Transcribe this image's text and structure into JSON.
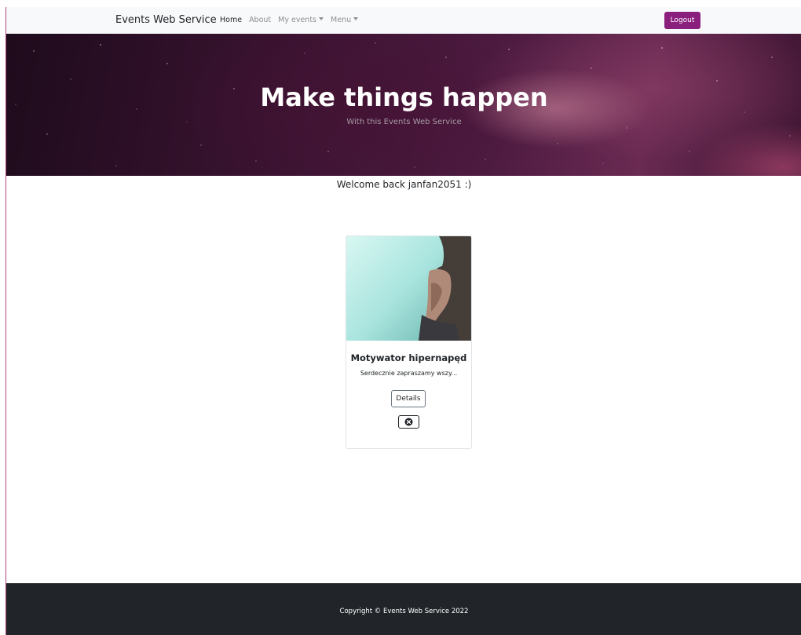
{
  "navbar": {
    "brand": "Events Web Service",
    "links": [
      {
        "label": "Home",
        "active": true
      },
      {
        "label": "About",
        "active": false
      },
      {
        "label": "My events",
        "dropdown": true
      },
      {
        "label": "Menu",
        "dropdown": true
      }
    ],
    "logout_label": "Logout"
  },
  "hero": {
    "title": "Make things happen",
    "subtitle": "With this Events Web Service"
  },
  "welcome_text": "Welcome back janfan2051 :)",
  "event_card": {
    "title": "Motywator hipernapęd",
    "description": "Serdecznie zapraszamy wszy...",
    "details_label": "Details",
    "remove_icon": "close-circle-icon"
  },
  "footer": {
    "copyright": "Copyright © Events Web Service 2022"
  },
  "colors": {
    "logout_button": "#8a1f7e",
    "footer_background": "#212529",
    "navbar_background": "#f8f9fa"
  }
}
